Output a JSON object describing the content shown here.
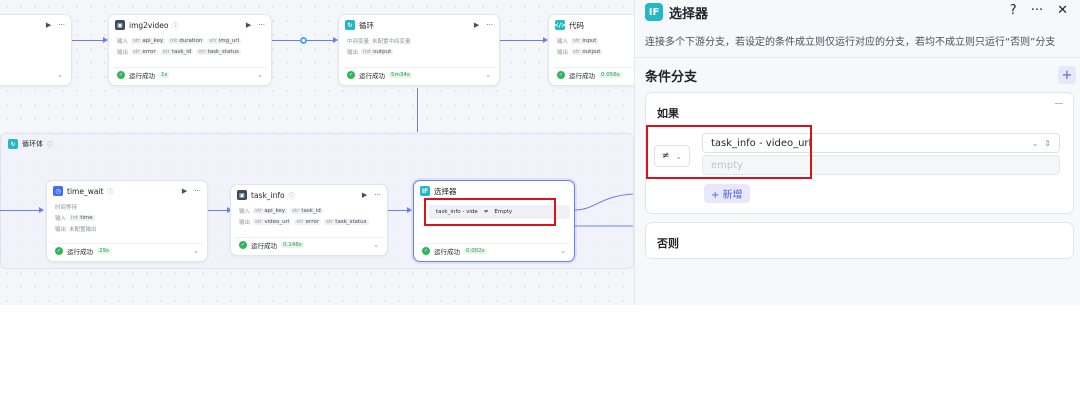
{
  "canvas": {
    "top_nodes": [
      {
        "title": "",
        "row1": "",
        "row2": ""
      },
      {
        "title": "img2video",
        "in_label": "输入",
        "out_label": "输出",
        "inputs": [
          "api_key",
          "duration",
          "img_url"
        ],
        "outputs": [
          "error",
          "task_id",
          "task_status"
        ],
        "status": "运行成功",
        "time": "1s"
      },
      {
        "title": "循环",
        "row1_label": "中间变量",
        "row1_value": "未配置中间变量",
        "out_label": "输出",
        "outputs": [
          "output"
        ],
        "status": "运行成功",
        "time": "5m34s"
      },
      {
        "title": "代码",
        "in_label": "输入",
        "out_label": "输出",
        "inputs": [
          "input"
        ],
        "outputs": [
          "output"
        ],
        "status": "运行成功",
        "time": "0.056s"
      }
    ],
    "loop_body": {
      "title": "循环体"
    },
    "loop_nodes": [
      {
        "title": "time_wait",
        "desc_label": "时间等待",
        "in_label": "输入",
        "inputs": [
          "time"
        ],
        "out_label": "输出",
        "out_value": "未配置输出",
        "status": "运行成功",
        "time": "29s"
      },
      {
        "title": "task_info",
        "in_label": "输入",
        "out_label": "输出",
        "inputs": [
          "api_key",
          "task_id"
        ],
        "outputs": [
          "video_url",
          "error",
          "task_status"
        ],
        "status": "运行成功",
        "time": "0.148s"
      },
      {
        "title": "选择器",
        "cond_var": "task_info - vide",
        "cond_op": "≠",
        "cond_val": "Empty",
        "status": "运行成功",
        "time": "0.002s"
      }
    ]
  },
  "panel": {
    "badge": "IF",
    "title": "选择器",
    "help_icon": "help-icon",
    "more_icon": "more-icon",
    "close_icon": "close-icon",
    "description": "连接多个下游分支，若设定的条件成立则仅运行对应的分支，若均不成立则只运行“否则”分支",
    "section_title": "条件分支",
    "if_title": "如果",
    "operator": "≠",
    "variable": "task_info - video_url",
    "value_placeholder": "empty",
    "add_label": "+ 新增",
    "else_title": "否则"
  },
  "colors": {
    "accent": "#4d5df0",
    "success": "#2fb65a",
    "highlight": "#d9121c",
    "if_badge": "#22b8c7"
  }
}
